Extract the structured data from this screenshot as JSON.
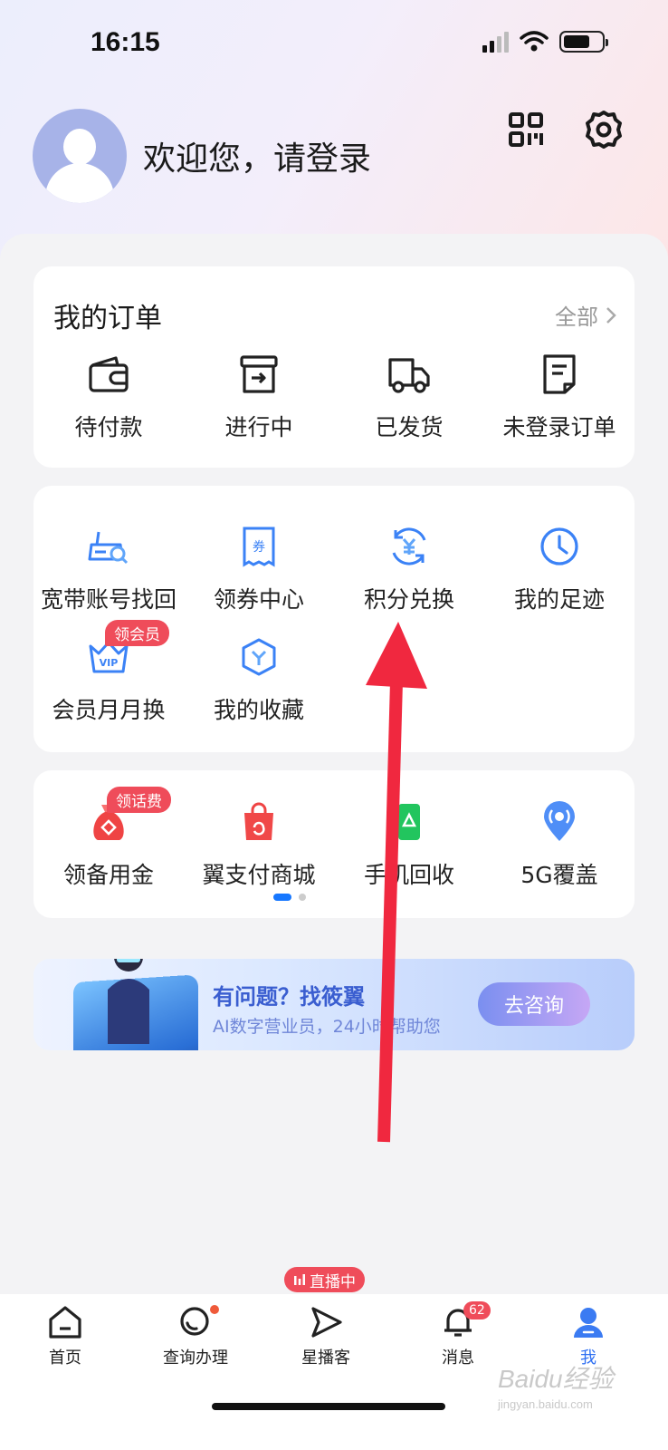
{
  "status_bar": {
    "time": "16:15"
  },
  "header": {
    "welcome": "欢迎您，请登录"
  },
  "orders": {
    "title": "我的订单",
    "view_all": "全部",
    "items": [
      {
        "label": "待付款",
        "icon": "wallet-icon"
      },
      {
        "label": "进行中",
        "icon": "box-icon"
      },
      {
        "label": "已发货",
        "icon": "truck-icon"
      },
      {
        "label": "未登录订单",
        "icon": "order-doc-icon"
      }
    ]
  },
  "services": {
    "items": [
      {
        "label": "宽带账号找回",
        "icon": "broadband-search-icon"
      },
      {
        "label": "领券中心",
        "icon": "coupon-icon"
      },
      {
        "label": "积分兑换",
        "icon": "points-exchange-icon"
      },
      {
        "label": "我的足迹",
        "icon": "clock-icon"
      },
      {
        "label": "会员月月换",
        "icon": "vip-crown-icon",
        "badge": "领会员"
      },
      {
        "label": "我的收藏",
        "icon": "favorite-icon"
      }
    ]
  },
  "promos": {
    "items": [
      {
        "label": "领备用金",
        "icon": "money-bag-icon",
        "badge": "领话费"
      },
      {
        "label": "翼支付商城",
        "icon": "shopping-bag-icon"
      },
      {
        "label": "手机回收",
        "icon": "phone-recycle-icon"
      },
      {
        "label": "5G覆盖",
        "icon": "location-signal-icon"
      }
    ],
    "page_count": 2,
    "active_page": 1
  },
  "ai_banner": {
    "title": "有问题？找筱翼",
    "subtitle": "AI数字营业员，24小时帮助您",
    "button": "去咨询"
  },
  "tabbar": {
    "live_badge": "直播中",
    "message_count": "62",
    "tabs": [
      {
        "label": "首页",
        "icon": "home-icon"
      },
      {
        "label": "查询办理",
        "icon": "search-query-icon"
      },
      {
        "label": "星播客",
        "icon": "play-icon"
      },
      {
        "label": "消息",
        "icon": "bell-icon"
      },
      {
        "label": "我",
        "icon": "user-icon",
        "active": true
      }
    ]
  },
  "watermark": {
    "text": "Baidu经验",
    "url": "jingyan.baidu.com"
  },
  "colors": {
    "accent": "#2e6ff2",
    "badge": "#ef4c5a",
    "arrow": "#f0283f"
  }
}
